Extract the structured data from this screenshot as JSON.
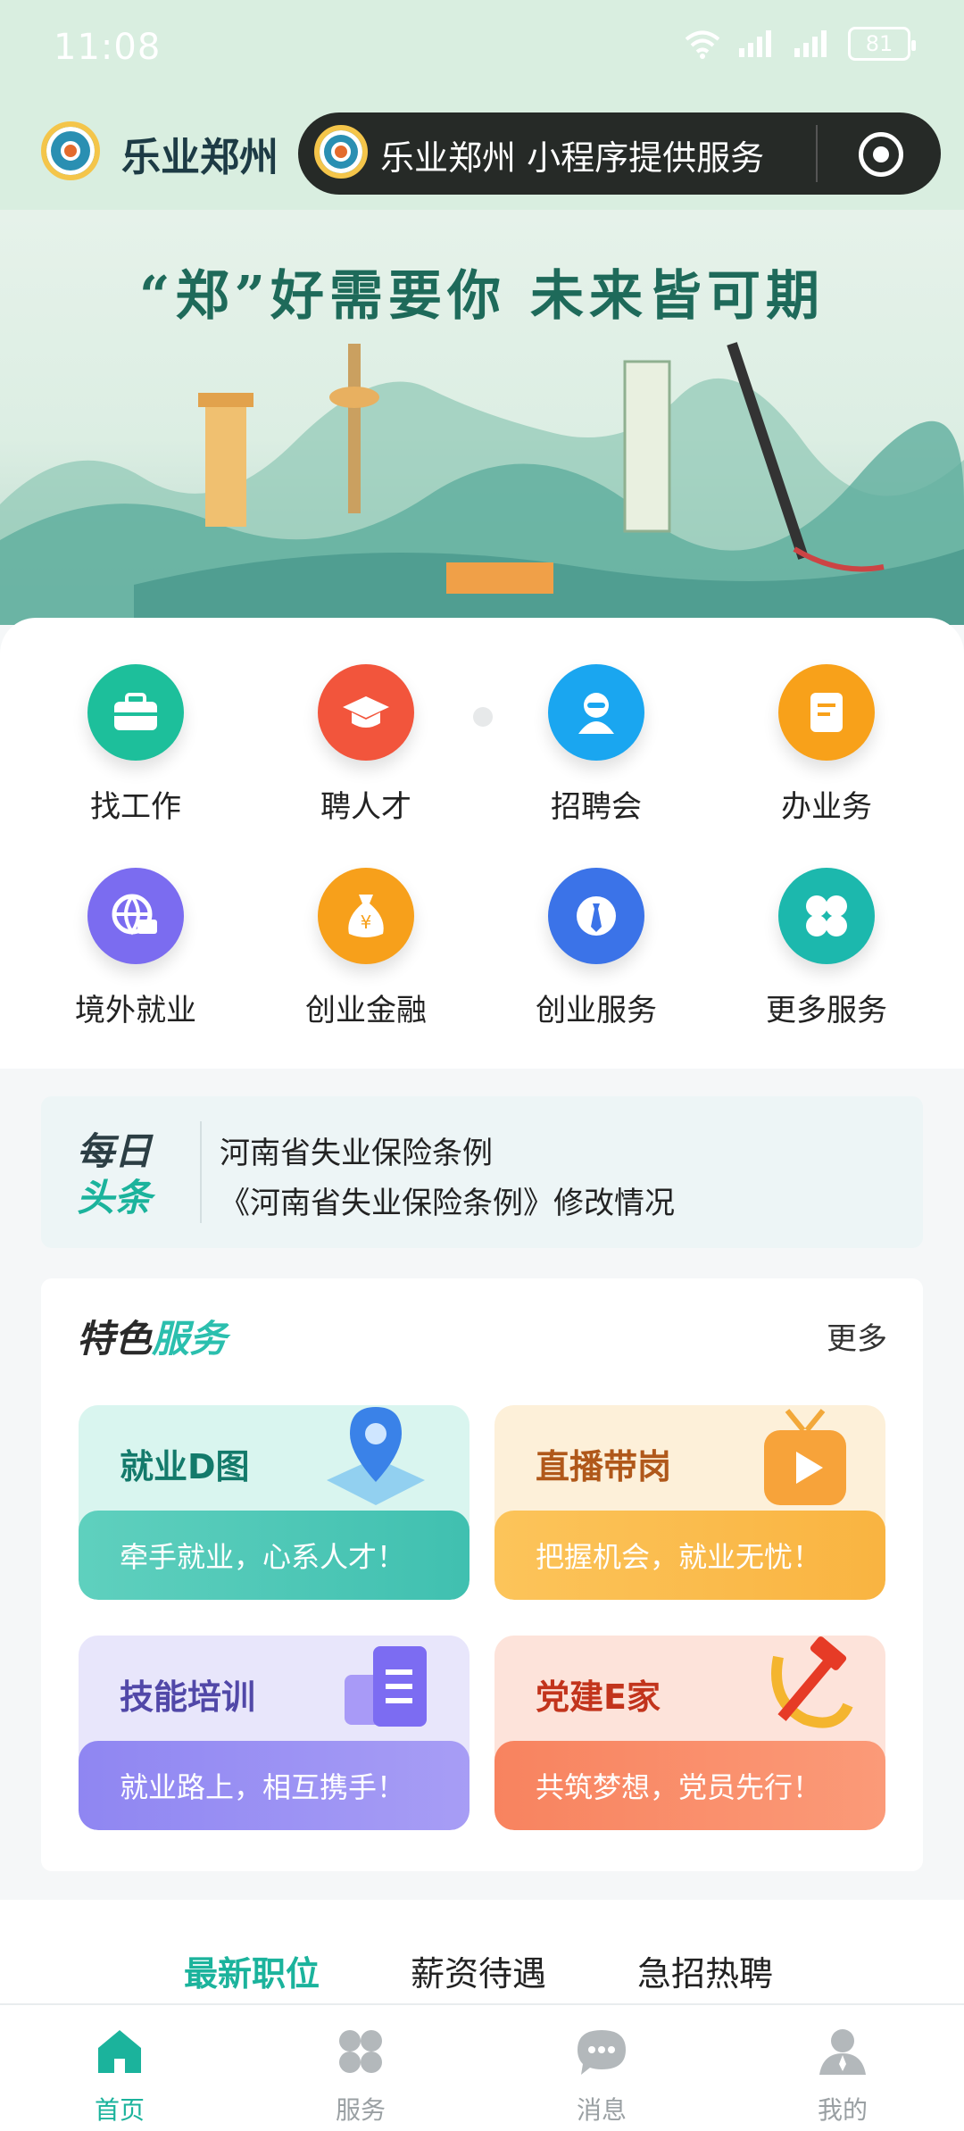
{
  "status_bar": {
    "time": "11:08",
    "battery": "81"
  },
  "header": {
    "app_title": "乐业郑州",
    "mini_program_text": "乐业郑州 小程序提供服务"
  },
  "banner": {
    "headline": "“郑”好需要你   未来皆可期"
  },
  "services": [
    {
      "label": "找工作",
      "icon": "briefcase-icon",
      "color": "#1dbf9b"
    },
    {
      "label": "聘人才",
      "icon": "graduation-cap-icon",
      "color": "#f2553c"
    },
    {
      "label": "招聘会",
      "icon": "person-icon",
      "color": "#1aa6f0"
    },
    {
      "label": "办业务",
      "icon": "document-icon",
      "color": "#f8a11a"
    },
    {
      "label": "境外就业",
      "icon": "globe-icon",
      "color": "#7b6cf0"
    },
    {
      "label": "创业金融",
      "icon": "money-bag-icon",
      "color": "#f7a01b"
    },
    {
      "label": "创业服务",
      "icon": "tie-icon",
      "color": "#3b73e8"
    },
    {
      "label": "更多服务",
      "icon": "clover-icon",
      "color": "#1cb8ad"
    }
  ],
  "daily_headline": {
    "badge_top": "每日",
    "badge_bottom": "头条",
    "lines": [
      "河南省失业保险条例",
      "《河南省失业保险条例》修改情况"
    ]
  },
  "featured": {
    "title_part1": "特色",
    "title_part2": "服务",
    "more": "更多",
    "cards": [
      {
        "title": "就业D图",
        "subtitle": "牵手就业，心系人才！",
        "icon": "map-pin-icon"
      },
      {
        "title": "直播带岗",
        "subtitle": "把握机会，就业无忧！",
        "icon": "tv-play-icon"
      },
      {
        "title": "技能培训",
        "subtitle": "就业路上，相互携手！",
        "icon": "book-stack-icon"
      },
      {
        "title": "党建E家",
        "subtitle": "共筑梦想，党员先行！",
        "icon": "hammer-sickle-icon"
      }
    ]
  },
  "job_tabs": [
    "最新职位",
    "薪资待遇",
    "急招热聘"
  ],
  "tabbar": [
    {
      "label": "首页",
      "icon": "home-icon"
    },
    {
      "label": "服务",
      "icon": "grid-icon"
    },
    {
      "label": "消息",
      "icon": "chat-icon"
    },
    {
      "label": "我的",
      "icon": "user-icon"
    }
  ],
  "colors": {
    "accent": "#1bb39c",
    "header_bg": "#d9eee0"
  }
}
